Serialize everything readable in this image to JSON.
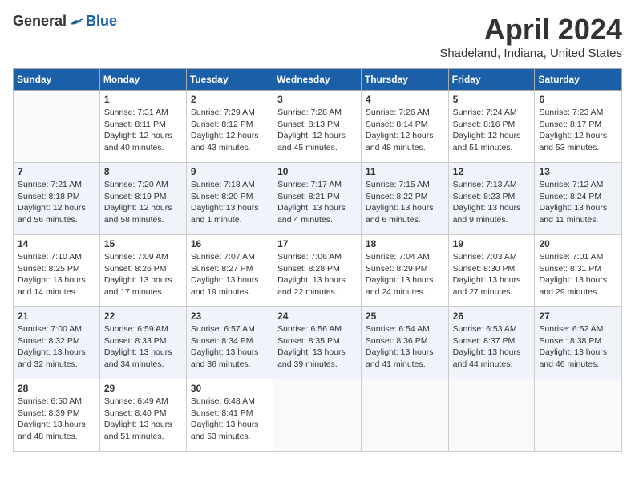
{
  "header": {
    "logo": {
      "general": "General",
      "blue": "Blue"
    },
    "title": "April 2024",
    "location": "Shadeland, Indiana, United States"
  },
  "days_of_week": [
    "Sunday",
    "Monday",
    "Tuesday",
    "Wednesday",
    "Thursday",
    "Friday",
    "Saturday"
  ],
  "weeks": [
    [
      {
        "day": "",
        "sunrise": "",
        "sunset": "",
        "daylight": ""
      },
      {
        "day": "1",
        "sunrise": "Sunrise: 7:31 AM",
        "sunset": "Sunset: 8:11 PM",
        "daylight": "Daylight: 12 hours and 40 minutes."
      },
      {
        "day": "2",
        "sunrise": "Sunrise: 7:29 AM",
        "sunset": "Sunset: 8:12 PM",
        "daylight": "Daylight: 12 hours and 43 minutes."
      },
      {
        "day": "3",
        "sunrise": "Sunrise: 7:28 AM",
        "sunset": "Sunset: 8:13 PM",
        "daylight": "Daylight: 12 hours and 45 minutes."
      },
      {
        "day": "4",
        "sunrise": "Sunrise: 7:26 AM",
        "sunset": "Sunset: 8:14 PM",
        "daylight": "Daylight: 12 hours and 48 minutes."
      },
      {
        "day": "5",
        "sunrise": "Sunrise: 7:24 AM",
        "sunset": "Sunset: 8:16 PM",
        "daylight": "Daylight: 12 hours and 51 minutes."
      },
      {
        "day": "6",
        "sunrise": "Sunrise: 7:23 AM",
        "sunset": "Sunset: 8:17 PM",
        "daylight": "Daylight: 12 hours and 53 minutes."
      }
    ],
    [
      {
        "day": "7",
        "sunrise": "Sunrise: 7:21 AM",
        "sunset": "Sunset: 8:18 PM",
        "daylight": "Daylight: 12 hours and 56 minutes."
      },
      {
        "day": "8",
        "sunrise": "Sunrise: 7:20 AM",
        "sunset": "Sunset: 8:19 PM",
        "daylight": "Daylight: 12 hours and 58 minutes."
      },
      {
        "day": "9",
        "sunrise": "Sunrise: 7:18 AM",
        "sunset": "Sunset: 8:20 PM",
        "daylight": "Daylight: 13 hours and 1 minute."
      },
      {
        "day": "10",
        "sunrise": "Sunrise: 7:17 AM",
        "sunset": "Sunset: 8:21 PM",
        "daylight": "Daylight: 13 hours and 4 minutes."
      },
      {
        "day": "11",
        "sunrise": "Sunrise: 7:15 AM",
        "sunset": "Sunset: 8:22 PM",
        "daylight": "Daylight: 13 hours and 6 minutes."
      },
      {
        "day": "12",
        "sunrise": "Sunrise: 7:13 AM",
        "sunset": "Sunset: 8:23 PM",
        "daylight": "Daylight: 13 hours and 9 minutes."
      },
      {
        "day": "13",
        "sunrise": "Sunrise: 7:12 AM",
        "sunset": "Sunset: 8:24 PM",
        "daylight": "Daylight: 13 hours and 11 minutes."
      }
    ],
    [
      {
        "day": "14",
        "sunrise": "Sunrise: 7:10 AM",
        "sunset": "Sunset: 8:25 PM",
        "daylight": "Daylight: 13 hours and 14 minutes."
      },
      {
        "day": "15",
        "sunrise": "Sunrise: 7:09 AM",
        "sunset": "Sunset: 8:26 PM",
        "daylight": "Daylight: 13 hours and 17 minutes."
      },
      {
        "day": "16",
        "sunrise": "Sunrise: 7:07 AM",
        "sunset": "Sunset: 8:27 PM",
        "daylight": "Daylight: 13 hours and 19 minutes."
      },
      {
        "day": "17",
        "sunrise": "Sunrise: 7:06 AM",
        "sunset": "Sunset: 8:28 PM",
        "daylight": "Daylight: 13 hours and 22 minutes."
      },
      {
        "day": "18",
        "sunrise": "Sunrise: 7:04 AM",
        "sunset": "Sunset: 8:29 PM",
        "daylight": "Daylight: 13 hours and 24 minutes."
      },
      {
        "day": "19",
        "sunrise": "Sunrise: 7:03 AM",
        "sunset": "Sunset: 8:30 PM",
        "daylight": "Daylight: 13 hours and 27 minutes."
      },
      {
        "day": "20",
        "sunrise": "Sunrise: 7:01 AM",
        "sunset": "Sunset: 8:31 PM",
        "daylight": "Daylight: 13 hours and 29 minutes."
      }
    ],
    [
      {
        "day": "21",
        "sunrise": "Sunrise: 7:00 AM",
        "sunset": "Sunset: 8:32 PM",
        "daylight": "Daylight: 13 hours and 32 minutes."
      },
      {
        "day": "22",
        "sunrise": "Sunrise: 6:59 AM",
        "sunset": "Sunset: 8:33 PM",
        "daylight": "Daylight: 13 hours and 34 minutes."
      },
      {
        "day": "23",
        "sunrise": "Sunrise: 6:57 AM",
        "sunset": "Sunset: 8:34 PM",
        "daylight": "Daylight: 13 hours and 36 minutes."
      },
      {
        "day": "24",
        "sunrise": "Sunrise: 6:56 AM",
        "sunset": "Sunset: 8:35 PM",
        "daylight": "Daylight: 13 hours and 39 minutes."
      },
      {
        "day": "25",
        "sunrise": "Sunrise: 6:54 AM",
        "sunset": "Sunset: 8:36 PM",
        "daylight": "Daylight: 13 hours and 41 minutes."
      },
      {
        "day": "26",
        "sunrise": "Sunrise: 6:53 AM",
        "sunset": "Sunset: 8:37 PM",
        "daylight": "Daylight: 13 hours and 44 minutes."
      },
      {
        "day": "27",
        "sunrise": "Sunrise: 6:52 AM",
        "sunset": "Sunset: 8:38 PM",
        "daylight": "Daylight: 13 hours and 46 minutes."
      }
    ],
    [
      {
        "day": "28",
        "sunrise": "Sunrise: 6:50 AM",
        "sunset": "Sunset: 8:39 PM",
        "daylight": "Daylight: 13 hours and 48 minutes."
      },
      {
        "day": "29",
        "sunrise": "Sunrise: 6:49 AM",
        "sunset": "Sunset: 8:40 PM",
        "daylight": "Daylight: 13 hours and 51 minutes."
      },
      {
        "day": "30",
        "sunrise": "Sunrise: 6:48 AM",
        "sunset": "Sunset: 8:41 PM",
        "daylight": "Daylight: 13 hours and 53 minutes."
      },
      {
        "day": "",
        "sunrise": "",
        "sunset": "",
        "daylight": ""
      },
      {
        "day": "",
        "sunrise": "",
        "sunset": "",
        "daylight": ""
      },
      {
        "day": "",
        "sunrise": "",
        "sunset": "",
        "daylight": ""
      },
      {
        "day": "",
        "sunrise": "",
        "sunset": "",
        "daylight": ""
      }
    ]
  ]
}
